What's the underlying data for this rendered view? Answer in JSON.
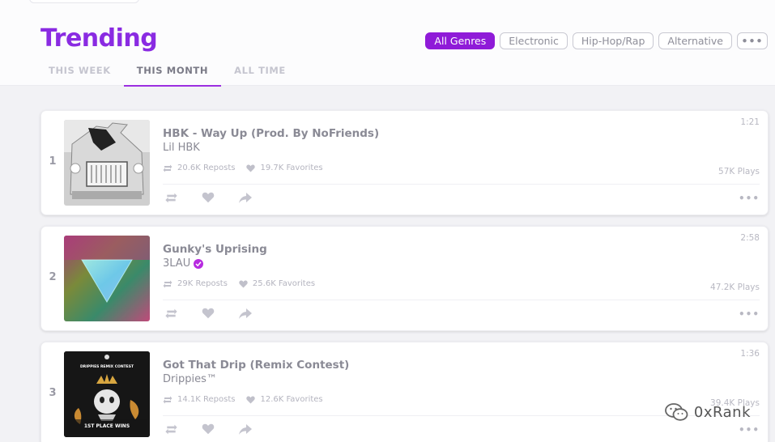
{
  "page_title": "Trending",
  "genres": [
    {
      "label": "All Genres",
      "active": true
    },
    {
      "label": "Electronic",
      "active": false
    },
    {
      "label": "Hip-Hop/Rap",
      "active": false
    },
    {
      "label": "Alternative",
      "active": false
    }
  ],
  "genres_more": "•••",
  "tabs": [
    {
      "label": "THIS WEEK",
      "active": false
    },
    {
      "label": "THIS MONTH",
      "active": true
    },
    {
      "label": "ALL TIME",
      "active": false
    }
  ],
  "tracks": [
    {
      "rank": "1",
      "title": "HBK - Way Up (Prod. By NoFriends)",
      "artist": "Lil HBK",
      "verified": false,
      "reposts": "20.6K Reposts",
      "favorites": "19.7K Favorites",
      "duration": "1:21",
      "plays": "57K Plays",
      "more": "•••"
    },
    {
      "rank": "2",
      "title": "Gunky's Uprising",
      "artist": "3LAU",
      "verified": true,
      "reposts": "29K Reposts",
      "favorites": "25.6K Favorites",
      "duration": "2:58",
      "plays": "47.2K Plays",
      "more": "•••"
    },
    {
      "rank": "3",
      "title": "Got That Drip (Remix Contest)",
      "artist": "Drippies™",
      "verified": false,
      "reposts": "14.1K Reposts",
      "favorites": "12.6K Favorites",
      "duration": "1:36",
      "plays": "39.4K Plays",
      "more": "•••",
      "art_text": {
        "top": "DRIPPIES REMIX CONTEST",
        "bottom": "1ST PLACE WINS"
      }
    }
  ],
  "watermark": "0xRank",
  "colors": {
    "accent": "#8f1bd8",
    "title": "#8a2be2",
    "verified": "#b72be0"
  },
  "icons": {
    "repost": "repost-icon",
    "favorite": "heart-icon",
    "share": "share-icon",
    "verified": "verified-check-icon"
  }
}
